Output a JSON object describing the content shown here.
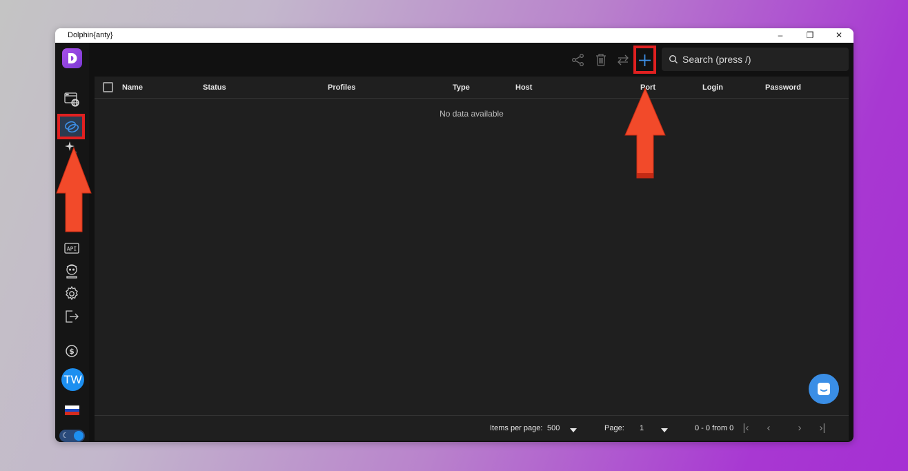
{
  "window": {
    "title": "Dolphin{anty}",
    "controls": {
      "minimize": "–",
      "restore": "❐",
      "close": "✕"
    }
  },
  "sidebar": {
    "items": [
      {
        "name": "browser-profiles",
        "icon": "browser-globe-icon"
      },
      {
        "name": "proxies",
        "icon": "proxy-link-icon",
        "active": true
      },
      {
        "name": "automation",
        "icon": "sparkle-icon"
      },
      {
        "name": "api",
        "icon": "api-icon"
      },
      {
        "name": "team",
        "icon": "user-face-icon"
      },
      {
        "name": "settings",
        "icon": "gear-icon"
      },
      {
        "name": "logout",
        "icon": "logout-icon"
      },
      {
        "name": "billing",
        "icon": "dollar-coin-icon"
      }
    ],
    "avatar_initials": "TW",
    "language_flag": "RU",
    "theme": "dark"
  },
  "toolbar": {
    "search_placeholder": "Search (press /)"
  },
  "table": {
    "columns": [
      "Name",
      "Status",
      "Profiles",
      "Type",
      "Host",
      "Port",
      "Login",
      "Password"
    ],
    "rows": [],
    "empty_text": "No data available"
  },
  "footer": {
    "items_per_page_label": "Items per page:",
    "items_per_page_value": "500",
    "page_label": "Page:",
    "page_value": "1",
    "range_text": "0 - 0 from 0"
  },
  "colors": {
    "accent": "#1d8ff0",
    "highlight": "#e02020",
    "arrow": "#f24a2a",
    "app_bg": "#111111"
  }
}
